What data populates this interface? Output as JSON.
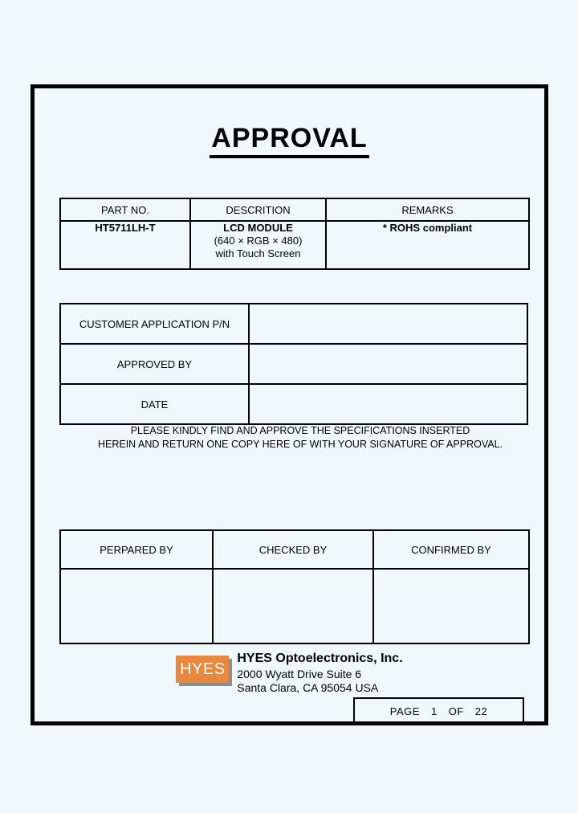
{
  "document": {
    "title": "APPROVAL"
  },
  "part_table": {
    "headers": [
      "PART NO.",
      "DESCRITION",
      "REMARKS"
    ],
    "row": {
      "part_no": "HT5711LH-T",
      "description_line1": "LCD MODULE",
      "description_line2": "(640 × RGB × 480)",
      "description_line3": "with Touch Screen",
      "remarks": "* ROHS compliant"
    }
  },
  "customer_table": {
    "rows": [
      {
        "label": "CUSTOMER APPLICATION P/N",
        "value": ""
      },
      {
        "label": "APPROVED BY",
        "value": ""
      },
      {
        "label": "DATE",
        "value": ""
      }
    ]
  },
  "note": {
    "line1": "PLEASE KINDLY FIND AND APPROVE THE SPECIFICATIONS INSERTED",
    "line2": "HEREIN AND RETURN ONE COPY HERE OF WITH YOUR SIGNATURE OF APPROVAL."
  },
  "signature_table": {
    "headers": [
      "PERPARED BY",
      "CHECKED BY",
      "CONFIRMED BY"
    ],
    "values": [
      "",
      "",
      ""
    ]
  },
  "company": {
    "logo_text": "HYES",
    "name": "HYES Optoelectronics, Inc.",
    "address_line1": "2000 Wyatt Drive Suite 6",
    "address_line2": "Santa Clara, CA 95054 USA",
    "logo_color": "#e8873e",
    "logo_shadow_color": "#8f8f8f"
  },
  "footer": {
    "page_label": "PAGE",
    "page_number": "1",
    "of_label": "OF",
    "total_pages": "22"
  }
}
